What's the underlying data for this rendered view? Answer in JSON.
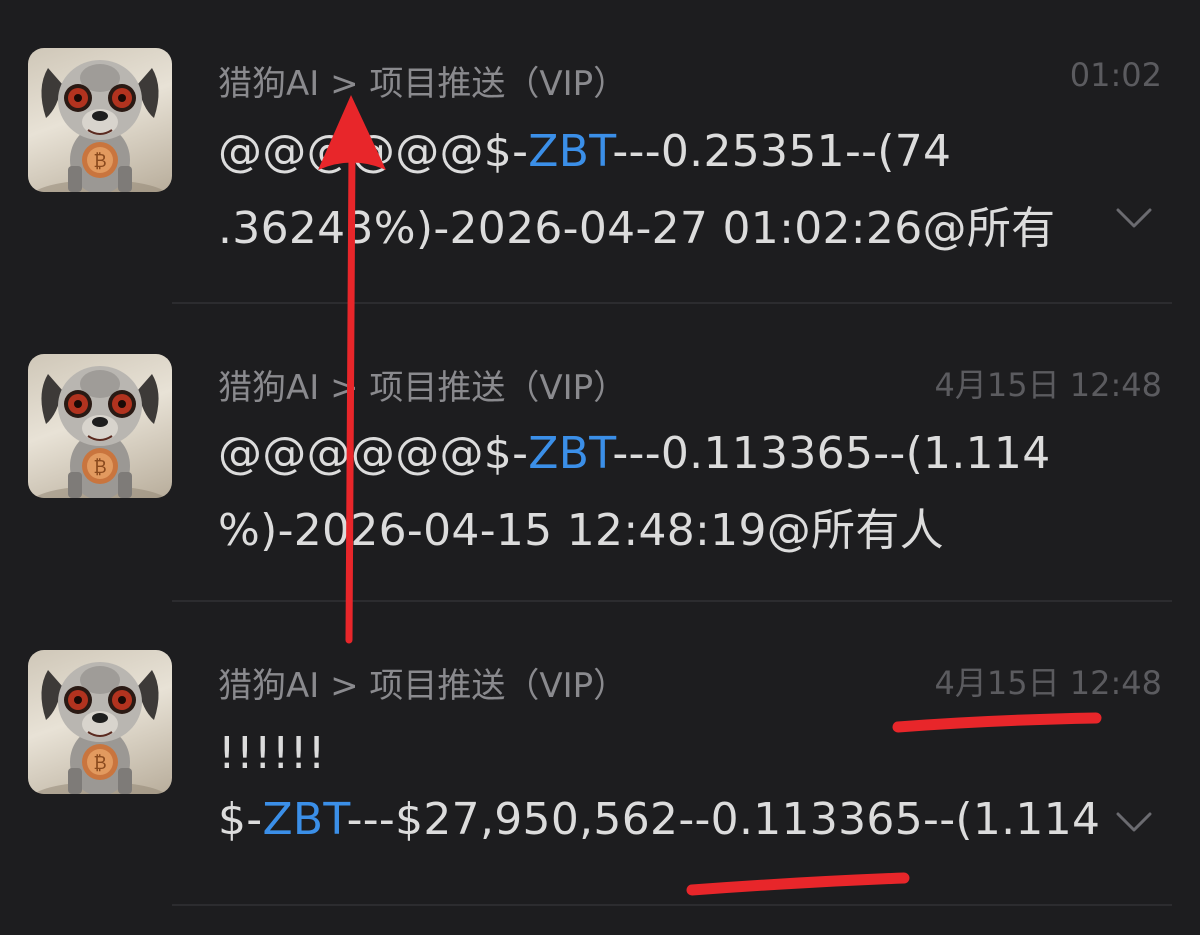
{
  "messages": [
    {
      "sender": "猎狗AI > 项目推送（VIP）",
      "time": "01:02",
      "line1": {
        "pre": "@@@@@@$-",
        "ticker": "ZBT",
        "post": "---0.25351--(74"
      },
      "line2": ".36243%)-2026-04-27 01:02:26@所有",
      "expand_icon": "chevron-down-icon"
    },
    {
      "sender": "猎狗AI > 项目推送（VIP）",
      "time": "4月15日 12:48",
      "line1": {
        "pre": "@@@@@@$-",
        "ticker": "ZBT",
        "post": "---0.113365--(1.114"
      },
      "line2": "%)-2026-04-15 12:48:19@所有人"
    },
    {
      "sender": "猎狗AI > 项目推送（VIP）",
      "time": "4月15日 12:48",
      "line1": "!!!!!!",
      "line2": {
        "pre": "$-",
        "ticker": "ZBT",
        "post": "---$27,950,562--0.113365--(1.114"
      },
      "expand_icon": "chevron-down-icon"
    }
  ],
  "avatar_icon": "robot-dog-bitcoin-avatar",
  "colors": {
    "background": "#1d1d1f",
    "text": "#dcdcdc",
    "sender": "#8a8a8e",
    "time": "#5b5b5f",
    "ticker": "#3b8fe8",
    "annotation": "#e8262a"
  },
  "annotations": [
    "red-arrow-up",
    "red-underline-time",
    "red-underline-price"
  ]
}
